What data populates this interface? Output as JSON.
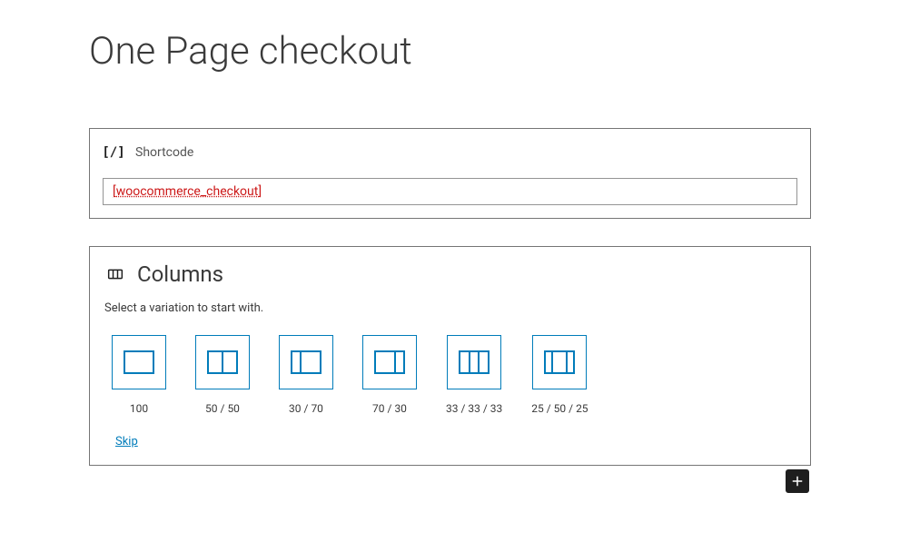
{
  "page": {
    "title": "One Page checkout"
  },
  "shortcode_block": {
    "label": "Shortcode",
    "value": "[woocommerce_checkout]"
  },
  "columns_block": {
    "title": "Columns",
    "subtitle": "Select a variation to start with.",
    "variations": [
      {
        "label": "100"
      },
      {
        "label": "50 / 50"
      },
      {
        "label": "30 / 70"
      },
      {
        "label": "70 / 30"
      },
      {
        "label": "33 / 33 / 33"
      },
      {
        "label": "25 / 50 / 25"
      }
    ],
    "skip_label": "Skip"
  }
}
